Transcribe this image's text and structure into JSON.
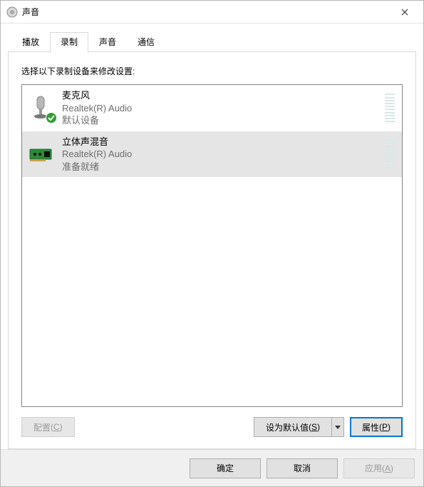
{
  "window": {
    "title": "声音"
  },
  "tabs": {
    "playback": "播放",
    "recording": "录制",
    "sounds": "声音",
    "communications": "通信",
    "active_index": 1
  },
  "instruction": "选择以下录制设备来修改设置:",
  "devices": [
    {
      "name": "麦克风",
      "driver": "Realtek(R) Audio",
      "status": "默认设备",
      "default": true,
      "selected": false,
      "icon": "microphone"
    },
    {
      "name": "立体声混音",
      "driver": "Realtek(R) Audio",
      "status": "准备就绪",
      "default": false,
      "selected": true,
      "icon": "soundcard"
    }
  ],
  "buttons": {
    "configure": {
      "label": "配置",
      "hotkey": "C",
      "enabled": false
    },
    "set_default": {
      "label": "设为默认值",
      "hotkey": "S",
      "enabled": true
    },
    "properties": {
      "label": "属性",
      "hotkey": "P",
      "enabled": true,
      "default_button": true
    },
    "ok": "确定",
    "cancel": "取消",
    "apply": {
      "label": "应用",
      "hotkey": "A",
      "enabled": false
    }
  }
}
